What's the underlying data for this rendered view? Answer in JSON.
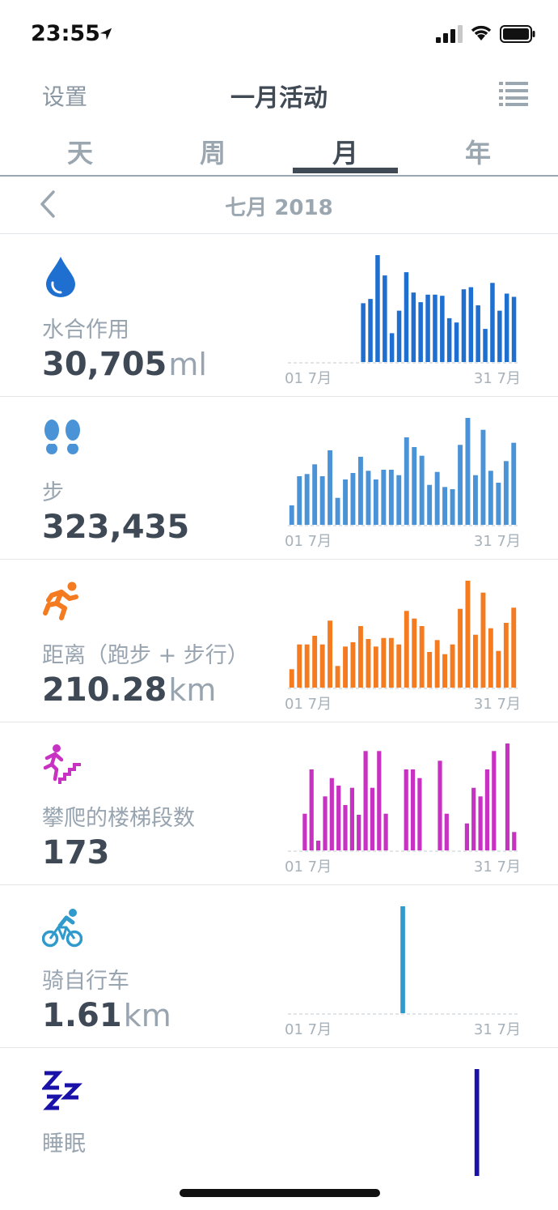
{
  "status_bar": {
    "time": "23:55"
  },
  "nav": {
    "left_label": "设置",
    "title": "一月活动"
  },
  "tabs": [
    {
      "label": "天",
      "active": false
    },
    {
      "label": "周",
      "active": false
    },
    {
      "label": "月",
      "active": true
    },
    {
      "label": "年",
      "active": false
    }
  ],
  "period": {
    "label": "七月 2018"
  },
  "metrics": [
    {
      "key": "water",
      "label": "水合作用",
      "value": "30,705",
      "unit": "ml",
      "icon": "water-drop-icon",
      "color": "#1f6fd1",
      "chart_data": {
        "type": "bar",
        "x_start": "01 7月",
        "x_end": "31 7月",
        "values": [
          0,
          0,
          0,
          0,
          0,
          0,
          0,
          0,
          0,
          0,
          55,
          59,
          100,
          81,
          27,
          48,
          84,
          65,
          56,
          63,
          63,
          62,
          41,
          37,
          68,
          70,
          53,
          31,
          74,
          48,
          64,
          61
        ]
      }
    },
    {
      "key": "steps",
      "label": "步",
      "value": "323,435",
      "unit": "",
      "icon": "footprints-icon",
      "color": "#4a93d6",
      "chart_data": {
        "type": "bar",
        "x_start": "01 7月",
        "x_end": "31 7月",
        "values": [
          18,
          45,
          47,
          56,
          45,
          69,
          25,
          42,
          48,
          63,
          50,
          42,
          51,
          51,
          46,
          81,
          72,
          64,
          37,
          49,
          35,
          33,
          74,
          99,
          46,
          88,
          50,
          39,
          59,
          76
        ]
      }
    },
    {
      "key": "distance",
      "label": "距离（跑步 + 步行）",
      "value": "210.28",
      "unit": "km",
      "icon": "runner-icon",
      "color": "#f47b20",
      "chart_data": {
        "type": "bar",
        "x_start": "01 7月",
        "x_end": "31 7月",
        "values": [
          17,
          40,
          40,
          48,
          40,
          62,
          20,
          38,
          42,
          57,
          45,
          38,
          46,
          46,
          40,
          71,
          64,
          57,
          33,
          44,
          31,
          40,
          73,
          99,
          49,
          88,
          55,
          34,
          60,
          74
        ]
      }
    },
    {
      "key": "stairs",
      "label": "攀爬的楼梯段数",
      "value": "173",
      "unit": "",
      "icon": "stairs-climber-icon",
      "color": "#c832c3",
      "chart_data": {
        "type": "bar",
        "x_start": "01 7月",
        "x_end": "31 7月",
        "values": [
          0,
          0,
          34,
          75,
          9,
          50,
          67,
          60,
          42,
          58,
          33,
          92,
          58,
          92,
          34,
          0,
          0,
          75,
          75,
          67,
          0,
          0,
          83,
          34,
          0,
          0,
          25,
          58,
          50,
          75,
          92,
          0,
          99,
          17
        ]
      }
    },
    {
      "key": "cycling",
      "label": "骑自行车",
      "value": "1.61",
      "unit": "km",
      "icon": "cyclist-icon",
      "color": "#2f9acb",
      "chart_data": {
        "type": "bar",
        "x_start": "01 7月",
        "x_end": "31 7月",
        "values": [
          0,
          0,
          0,
          0,
          0,
          0,
          0,
          0,
          0,
          0,
          0,
          0,
          0,
          0,
          0,
          100,
          0,
          0,
          0,
          0,
          0,
          0,
          0,
          0,
          0,
          0,
          0,
          0,
          0,
          0,
          0
        ]
      }
    },
    {
      "key": "sleep",
      "label": "睡眠",
      "value": "",
      "unit": "",
      "icon": "sleep-zzz-icon",
      "color": "#1a12a8",
      "chart_data": {
        "type": "bar",
        "x_start": "",
        "x_end": "",
        "values": [
          0,
          0,
          0,
          0,
          0,
          0,
          0,
          0,
          0,
          0,
          0,
          0,
          0,
          0,
          0,
          0,
          0,
          0,
          0,
          0,
          0,
          0,
          0,
          0,
          0,
          100,
          0,
          0,
          0,
          0,
          0
        ]
      }
    }
  ]
}
